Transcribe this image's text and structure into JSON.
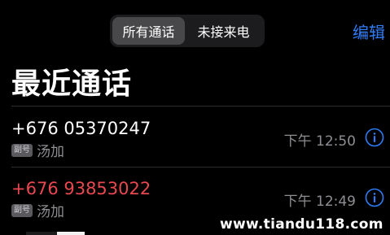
{
  "segmented": {
    "all_calls": "所有通话",
    "missed": "未接来电"
  },
  "edit_label": "编辑",
  "page_title": "最近通话",
  "calls": [
    {
      "number": "+676 05370247",
      "badge": "副号",
      "location": "汤加",
      "time": "下午 12:50",
      "missed": false
    },
    {
      "number": "+676 93853022",
      "badge": "副号",
      "location": "汤加",
      "time": "下午 12:49",
      "missed": true
    }
  ],
  "watermark": "www.tiandu118.com",
  "colors": {
    "accent": "#2f7cf6",
    "missed": "#e8484f",
    "secondary_text": "#8e8e93"
  }
}
